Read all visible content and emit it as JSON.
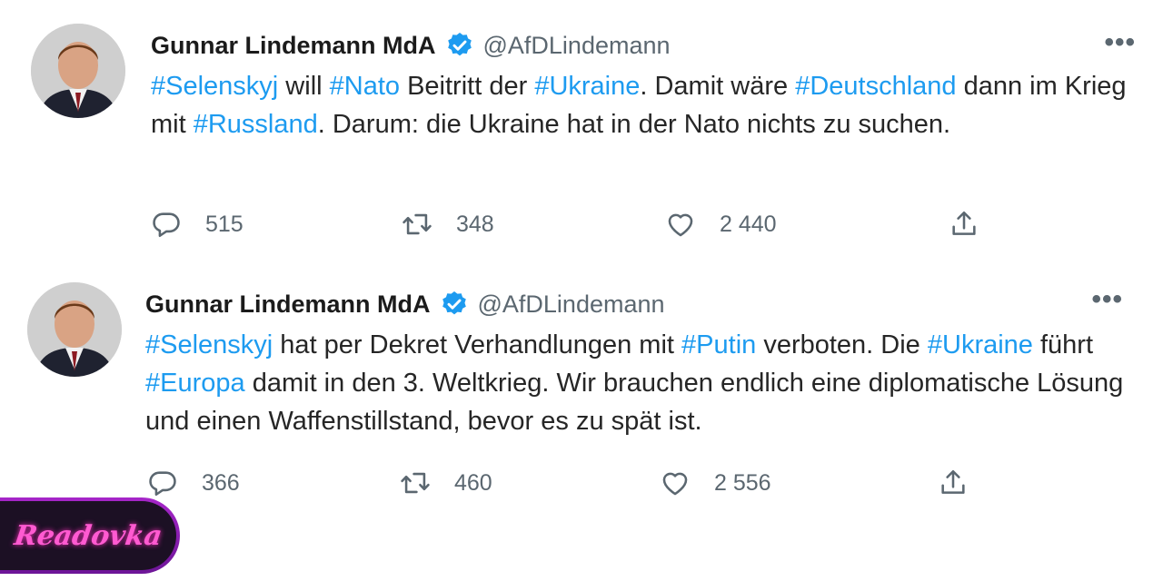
{
  "tweets": [
    {
      "author": "Gunnar Lindemann MdA",
      "handle": "@AfDLindemann",
      "more": "•••",
      "body": [
        {
          "text": "#Selenskyj",
          "tag": true
        },
        {
          "text": " will ",
          "tag": false
        },
        {
          "text": "#Nato",
          "tag": true
        },
        {
          "text": " Beitritt der ",
          "tag": false
        },
        {
          "text": "#Ukraine",
          "tag": true
        },
        {
          "text": ". Damit wäre ",
          "tag": false
        },
        {
          "text": "#Deutschland",
          "tag": true
        },
        {
          "text": " dann im Krieg mit ",
          "tag": false
        },
        {
          "text": "#Russland",
          "tag": true
        },
        {
          "text": ". Darum: die Ukraine hat in der Nato nichts zu suchen.",
          "tag": false
        }
      ],
      "replies": "515",
      "retweets": "348",
      "likes": "2 440"
    },
    {
      "author": "Gunnar Lindemann MdA",
      "handle": "@AfDLindemann",
      "more": "•••",
      "body": [
        {
          "text": "#Selenskyj",
          "tag": true
        },
        {
          "text": " hat per Dekret Verhandlungen mit ",
          "tag": false
        },
        {
          "text": "#Putin",
          "tag": true
        },
        {
          "text": " verboten. Die ",
          "tag": false
        },
        {
          "text": "#Ukraine",
          "tag": true
        },
        {
          "text": " führt ",
          "tag": false
        },
        {
          "text": "#Europa",
          "tag": true
        },
        {
          "text": " damit in den 3. Weltkrieg. Wir brauchen endlich eine diplomatische Lösung und einen Waffenstillstand, bevor es zu spät ist.",
          "tag": false
        }
      ],
      "replies": "366",
      "retweets": "460",
      "likes": "2 556"
    }
  ],
  "colors": {
    "hashtag": "#1d9bf0",
    "verified": "#1d9bf0",
    "muted": "#5b6770"
  },
  "icons": [
    "reply-icon",
    "retweet-icon",
    "like-icon",
    "share-icon",
    "verified-badge-icon",
    "more-options-icon"
  ],
  "watermark": "Readovka"
}
